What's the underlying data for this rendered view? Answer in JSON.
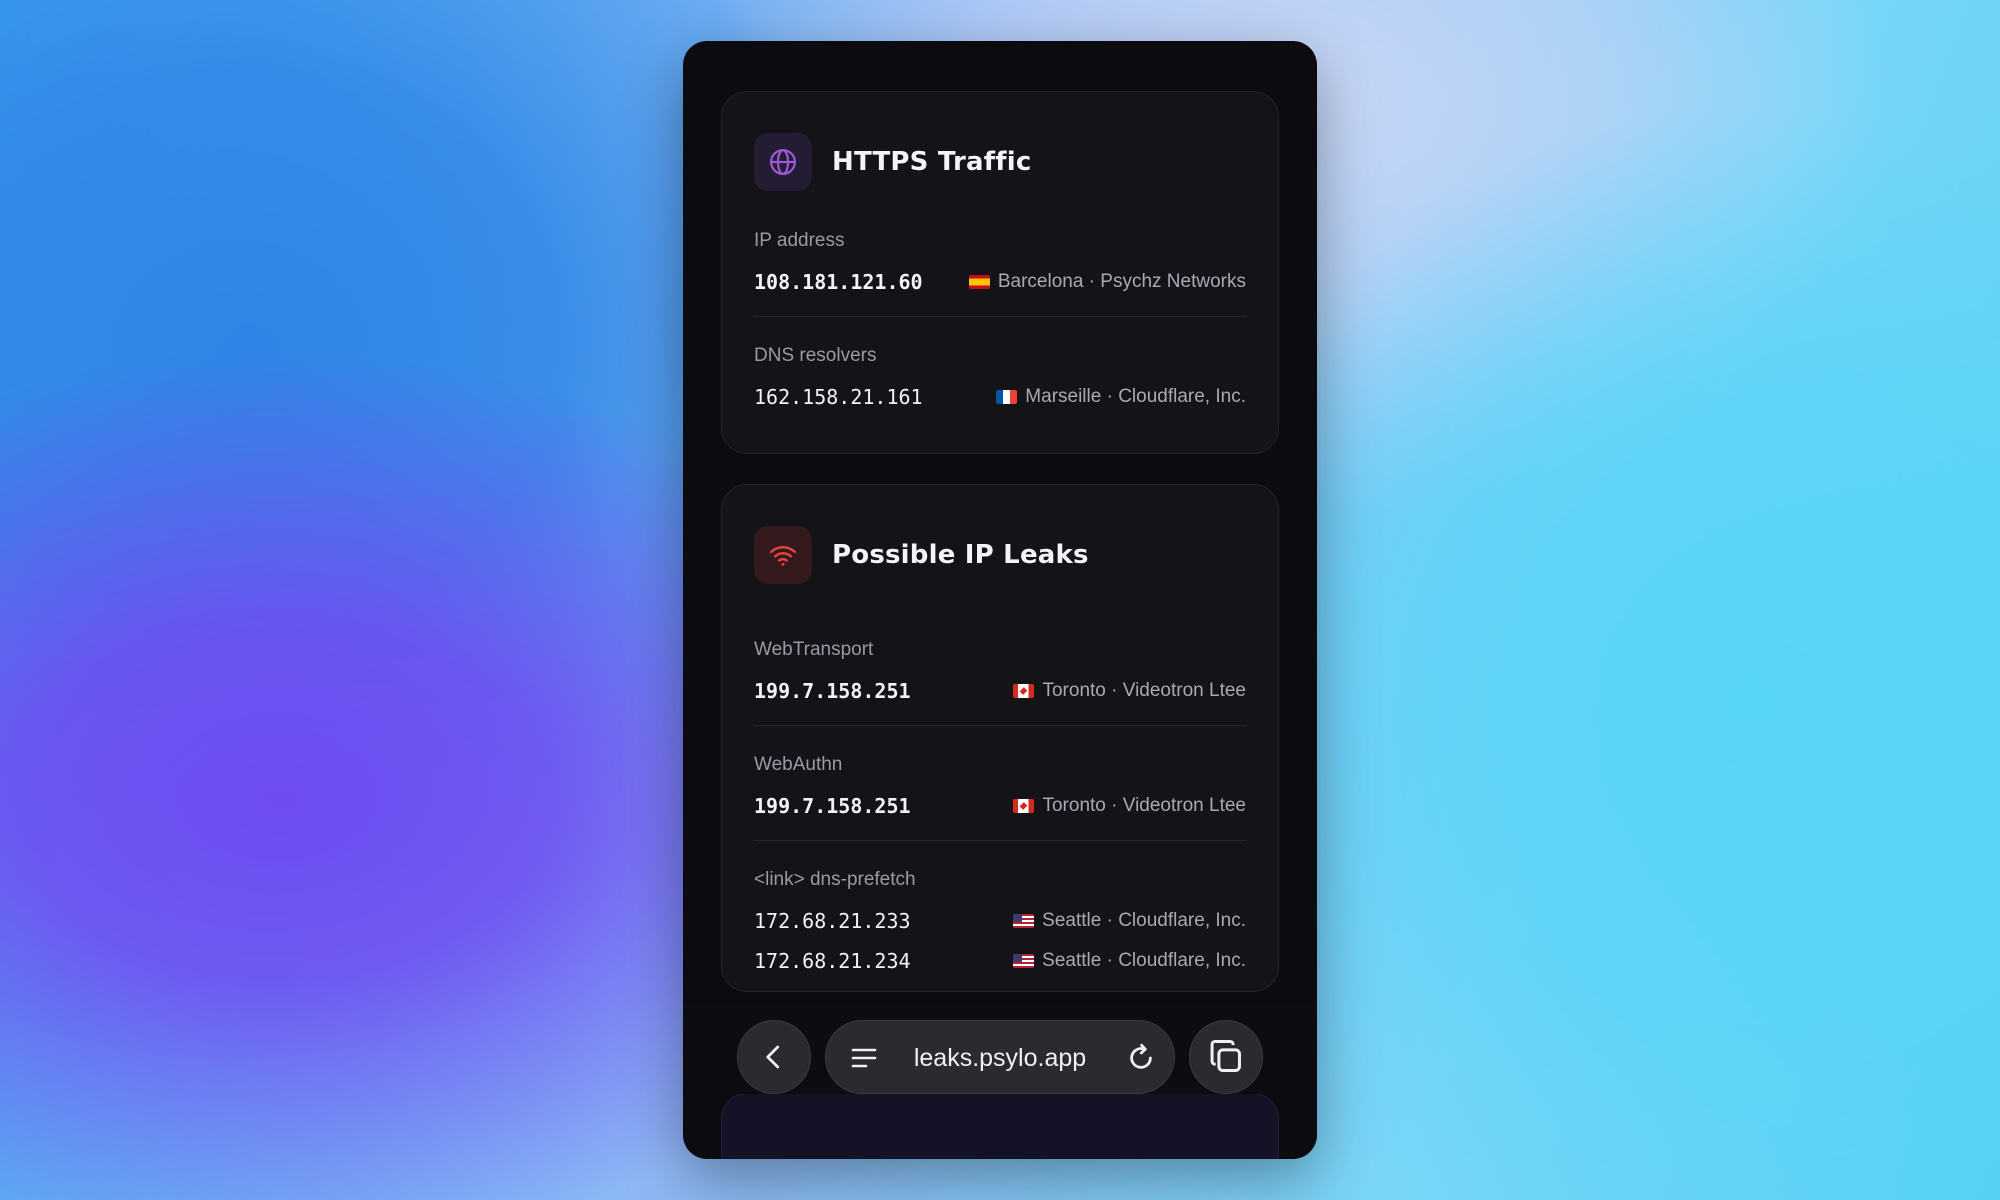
{
  "browser": {
    "url": "leaks.psylo.app",
    "icons": {
      "back": "chevron-left-icon",
      "menu": "menu-lines-icon",
      "reload": "reload-icon",
      "tabs": "tabs-icon"
    }
  },
  "colors": {
    "page_bg": "#0c0c10",
    "card_bg": "#131318",
    "violet_accent": "#9b59d6",
    "red_accent": "#e0453d",
    "label_gray": "#9a9aa6"
  },
  "https_card": {
    "title": "HTTPS Traffic",
    "icon": "globe-icon",
    "rows": [
      {
        "label": "IP address",
        "entries": [
          {
            "ip": "108.181.121.60",
            "flag": "es",
            "location": "Barcelona · Psychz Networks"
          }
        ]
      },
      {
        "label": "DNS resolvers",
        "entries": [
          {
            "ip": "162.158.21.161",
            "flag": "fr",
            "location": "Marseille · Cloudflare, Inc."
          }
        ]
      }
    ]
  },
  "leaks_card": {
    "title": "Possible IP Leaks",
    "icon": "wifi-icon",
    "rows": [
      {
        "label": "WebTransport",
        "entries": [
          {
            "ip": "199.7.158.251",
            "flag": "ca",
            "location": "Toronto · Videotron Ltee"
          }
        ]
      },
      {
        "label": "WebAuthn",
        "entries": [
          {
            "ip": "199.7.158.251",
            "flag": "ca",
            "location": "Toronto · Videotron Ltee"
          }
        ]
      },
      {
        "label": "<link> dns-prefetch",
        "entries": [
          {
            "ip": "172.68.21.233",
            "flag": "us",
            "location": "Seattle · Cloudflare, Inc."
          },
          {
            "ip": "172.68.21.234",
            "flag": "us",
            "location": "Seattle · Cloudflare, Inc."
          }
        ]
      }
    ]
  }
}
